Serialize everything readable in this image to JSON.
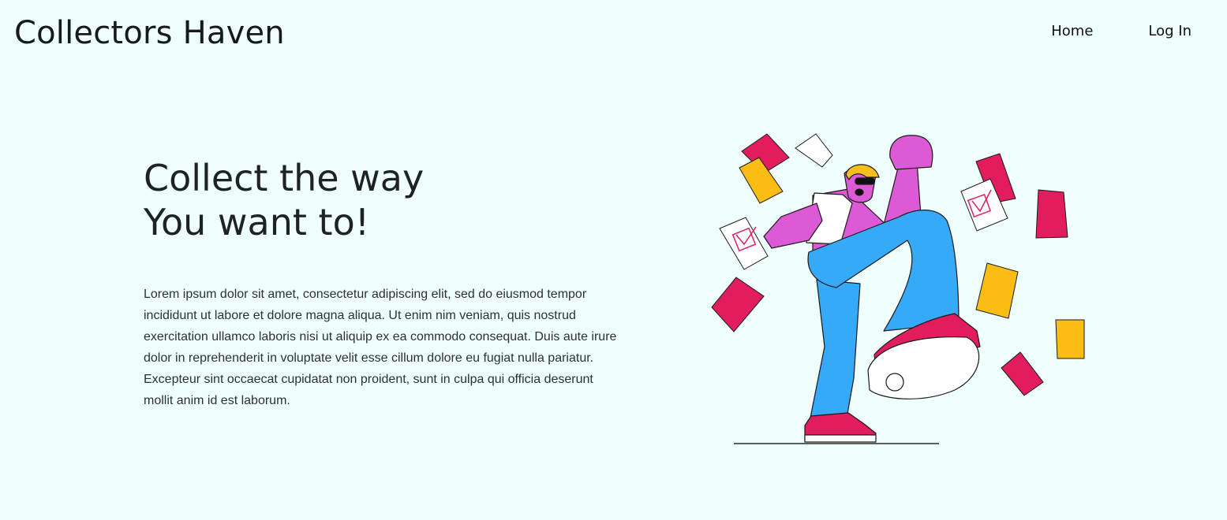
{
  "header": {
    "brand": "Collectors Haven",
    "nav": [
      {
        "label": "Home"
      },
      {
        "label": "Log In"
      }
    ]
  },
  "hero": {
    "title_line1": "Collect the way",
    "title_line2": "You want to!",
    "body": "Lorem ipsum dolor sit amet, consectetur adipiscing elit, sed do eiusmod tempor incididunt ut labore et dolore magna aliqua. Ut enim nim veniam, quis nostrud exercitation ullamco laboris nisi ut aliquip ex ea commodo consequat. Duis aute irure dolor in reprehenderit in voluptate velit esse cillum dolore eu fugiat nulla pariatur. Excepteur sint occaecat cupidatat non proident, sunt in culpa qui officia deserunt mollit anim id est laborum."
  },
  "illustration": {
    "subject": "celebrating-person-with-flying-papers",
    "colors": {
      "magenta": "#e11d5e",
      "yellow": "#fbbd14",
      "skin": "#dd5ad6",
      "jeans": "#36a9f8",
      "hair": "#f6bf1e",
      "shirt": "#ffffff"
    }
  }
}
